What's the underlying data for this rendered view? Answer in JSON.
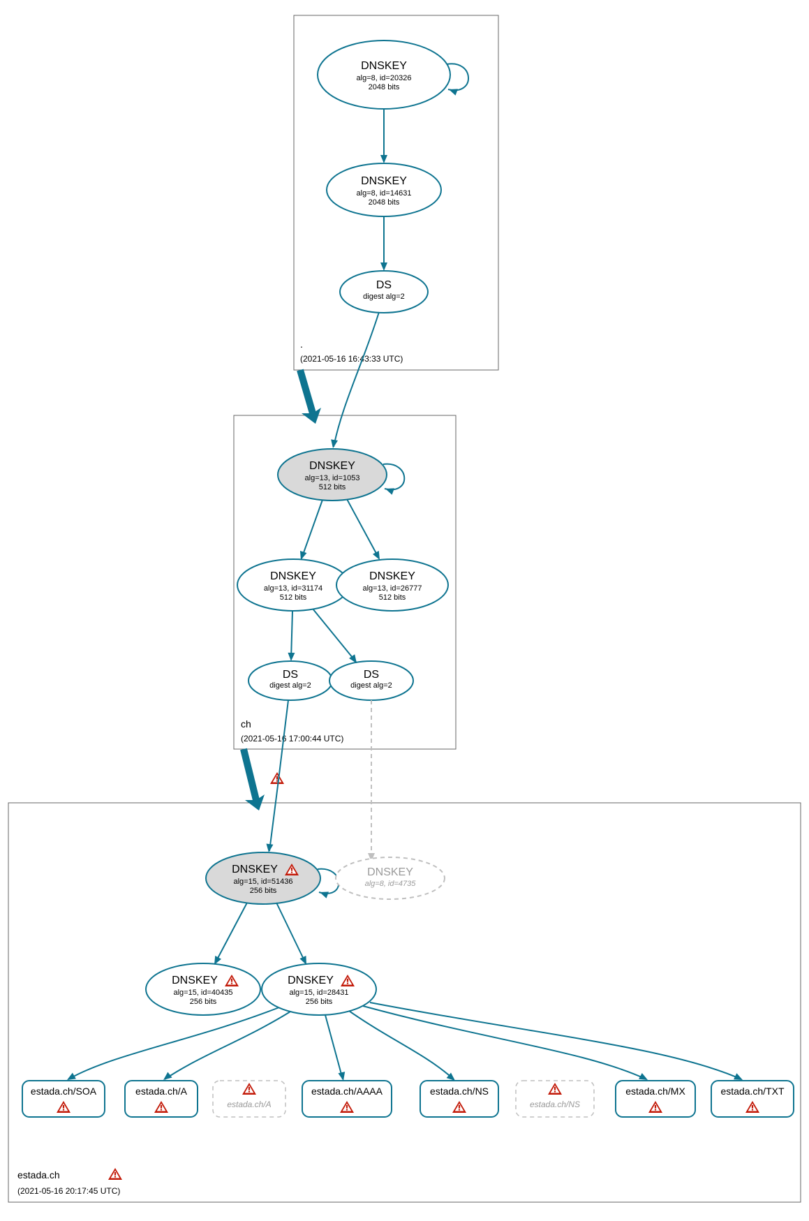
{
  "diagram_type": "DNSSEC authentication chain graph",
  "colors": {
    "node_stroke": "#0e7490",
    "trust_fill": "#d9d9d9",
    "dashed_stroke": "#bfbfbf",
    "warning": "#c21807"
  },
  "zones": {
    "root": {
      "label": ".",
      "timestamp": "(2021-05-16 16:43:33 UTC)"
    },
    "ch": {
      "label": "ch",
      "timestamp": "(2021-05-16 17:00:44 UTC)"
    },
    "estada": {
      "label": "estada.ch",
      "timestamp": "(2021-05-16 20:17:45 UTC)"
    }
  },
  "nodes": {
    "root_ksk": {
      "title": "DNSKEY",
      "l1": "alg=8, id=20326",
      "l2": "2048 bits"
    },
    "root_zsk": {
      "title": "DNSKEY",
      "l1": "alg=8, id=14631",
      "l2": "2048 bits"
    },
    "root_ds": {
      "title": "DS",
      "l1": "digest alg=2"
    },
    "ch_ksk": {
      "title": "DNSKEY",
      "l1": "alg=13, id=1053",
      "l2": "512 bits"
    },
    "ch_zsk1": {
      "title": "DNSKEY",
      "l1": "alg=13, id=31174",
      "l2": "512 bits"
    },
    "ch_zsk2": {
      "title": "DNSKEY",
      "l1": "alg=13, id=26777",
      "l2": "512 bits"
    },
    "ch_ds1": {
      "title": "DS",
      "l1": "digest alg=2"
    },
    "ch_ds2": {
      "title": "DS",
      "l1": "digest alg=2"
    },
    "est_ksk": {
      "title": "DNSKEY",
      "l1": "alg=15, id=51436",
      "l2": "256 bits"
    },
    "est_missing": {
      "title": "DNSKEY",
      "l1": "alg=8, id=4735"
    },
    "est_zsk1": {
      "title": "DNSKEY",
      "l1": "alg=15, id=40435",
      "l2": "256 bits"
    },
    "est_zsk2": {
      "title": "DNSKEY",
      "l1": "alg=15, id=28431",
      "l2": "256 bits"
    },
    "rr_soa": {
      "title": "estada.ch/SOA"
    },
    "rr_a": {
      "title": "estada.ch/A"
    },
    "rr_a_na": {
      "title": "estada.ch/A"
    },
    "rr_aaaa": {
      "title": "estada.ch/AAAA"
    },
    "rr_ns": {
      "title": "estada.ch/NS"
    },
    "rr_ns_na": {
      "title": "estada.ch/NS"
    },
    "rr_mx": {
      "title": "estada.ch/MX"
    },
    "rr_txt": {
      "title": "estada.ch/TXT"
    }
  }
}
